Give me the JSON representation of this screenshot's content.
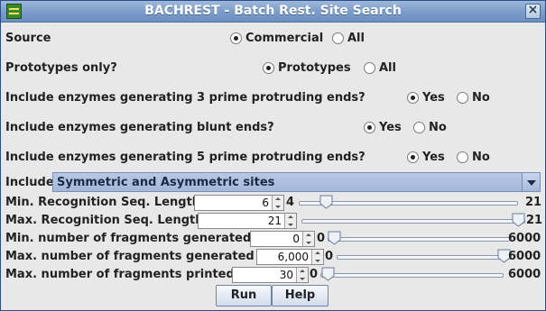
{
  "window": {
    "title": "BACHREST - Batch Rest. Site Search"
  },
  "source": {
    "label": "Source",
    "opt1": "Commercial",
    "opt2": "All",
    "selected": "Commercial"
  },
  "prototypes": {
    "label": "Prototypes only?",
    "opt1": "Prototypes",
    "opt2": "All",
    "selected": "Prototypes"
  },
  "three_prime": {
    "label": "Include enzymes generating 3 prime protruding ends?",
    "opt1": "Yes",
    "opt2": "No",
    "selected": "Yes"
  },
  "blunt": {
    "label": "Include enzymes generating blunt ends?",
    "opt1": "Yes",
    "opt2": "No",
    "selected": "Yes"
  },
  "five_prime": {
    "label": "Include enzymes generating 5 prime protruding ends?",
    "opt1": "Yes",
    "opt2": "No",
    "selected": "Yes"
  },
  "include": {
    "label": "Include",
    "value": "Symmetric and Asymmetric sites"
  },
  "min_recog": {
    "label": "Min. Recognition Seq. Length",
    "value": "6",
    "min": "4",
    "max": "21",
    "level": 0.1
  },
  "max_recog": {
    "label": "Max. Recognition Seq. Length",
    "value": "21",
    "min": "4",
    "max": "21",
    "level": 1.0
  },
  "min_frag": {
    "label": "Min. number of fragments generated",
    "value": "0",
    "min": "0",
    "max": "6000",
    "level": 0.0
  },
  "max_frag": {
    "label": "Max. number of fragments generated",
    "value": "6,000",
    "min": "0",
    "max": "6000",
    "level": 1.0
  },
  "max_print": {
    "label": "Max. number of fragments printed",
    "value": "30",
    "min": "0",
    "max": "6000",
    "level": 0.005
  },
  "buttons": {
    "run": "Run",
    "help": "Help"
  },
  "colors": {
    "title_bar": "#7a9ac8",
    "combo": "#a4b8dc",
    "background": "#e8e8e8"
  }
}
